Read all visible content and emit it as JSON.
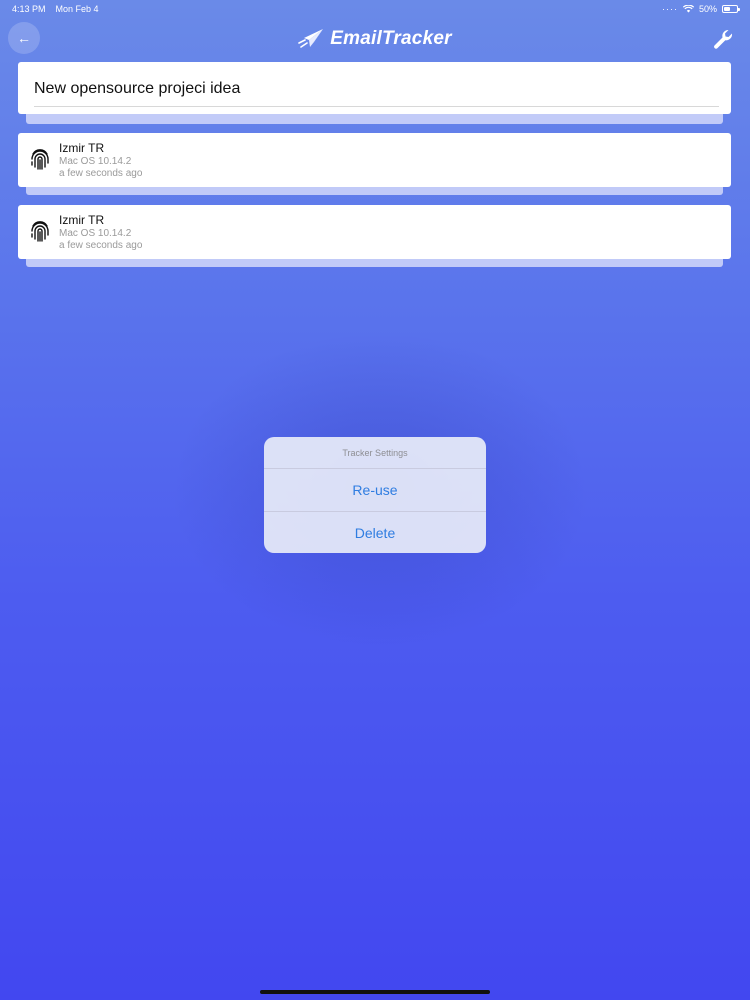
{
  "status_bar": {
    "time": "4:13 PM",
    "date": "Mon Feb 4",
    "battery": "50%",
    "battery_level": 0.5
  },
  "header": {
    "brand_name": "EmailTracker",
    "back_icon": "back-arrow-icon",
    "settings_icon": "wrench-icon"
  },
  "email": {
    "subject": "New opensource projeci idea"
  },
  "trackers": [
    {
      "name": "Izmir TR",
      "os": "Mac OS 10.14.2",
      "time": "a few seconds ago",
      "icon": "fingerprint-icon"
    },
    {
      "name": "Izmir TR",
      "os": "Mac OS 10.14.2",
      "time": "a few seconds ago",
      "icon": "fingerprint-icon"
    }
  ],
  "action_sheet": {
    "title": "Tracker Settings",
    "actions": [
      "Re-use",
      "Delete"
    ]
  },
  "colors": {
    "accent": "#2f7de1",
    "background_top": "#6a8ae8",
    "background_bottom": "#4247f0"
  }
}
